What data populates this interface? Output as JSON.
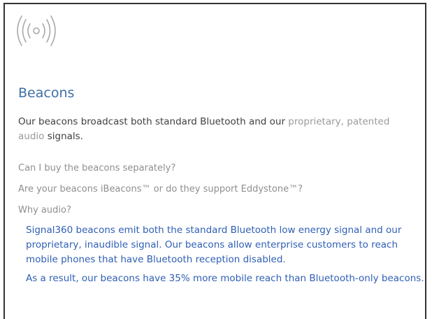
{
  "section": {
    "title": "Beacons",
    "icon": "broadcast-signal-icon",
    "intro": {
      "part1": "Our beacons broadcast both standard Bluetooth and our ",
      "part2": "proprietary, patented audio",
      "part3": " signals."
    }
  },
  "faq": [
    {
      "question": "Can I buy the beacons separately?"
    },
    {
      "question": "Are your beacons iBeacons™ or do they support Eddystone™?"
    },
    {
      "question": "Why audio?",
      "answers": [
        "Signal360 beacons emit both the standard Bluetooth low energy signal and our proprietary, inaudible signal. Our beacons allow enterprise customers to reach mobile phones that have Bluetooth reception disabled.",
        "As a result, our beacons have 35% more mobile reach than Bluetooth-only beacons."
      ]
    }
  ],
  "colors": {
    "title": "#3d6fa6",
    "answer": "#2f5fb5",
    "muted": "#9a9a9a",
    "body": "#404040"
  }
}
